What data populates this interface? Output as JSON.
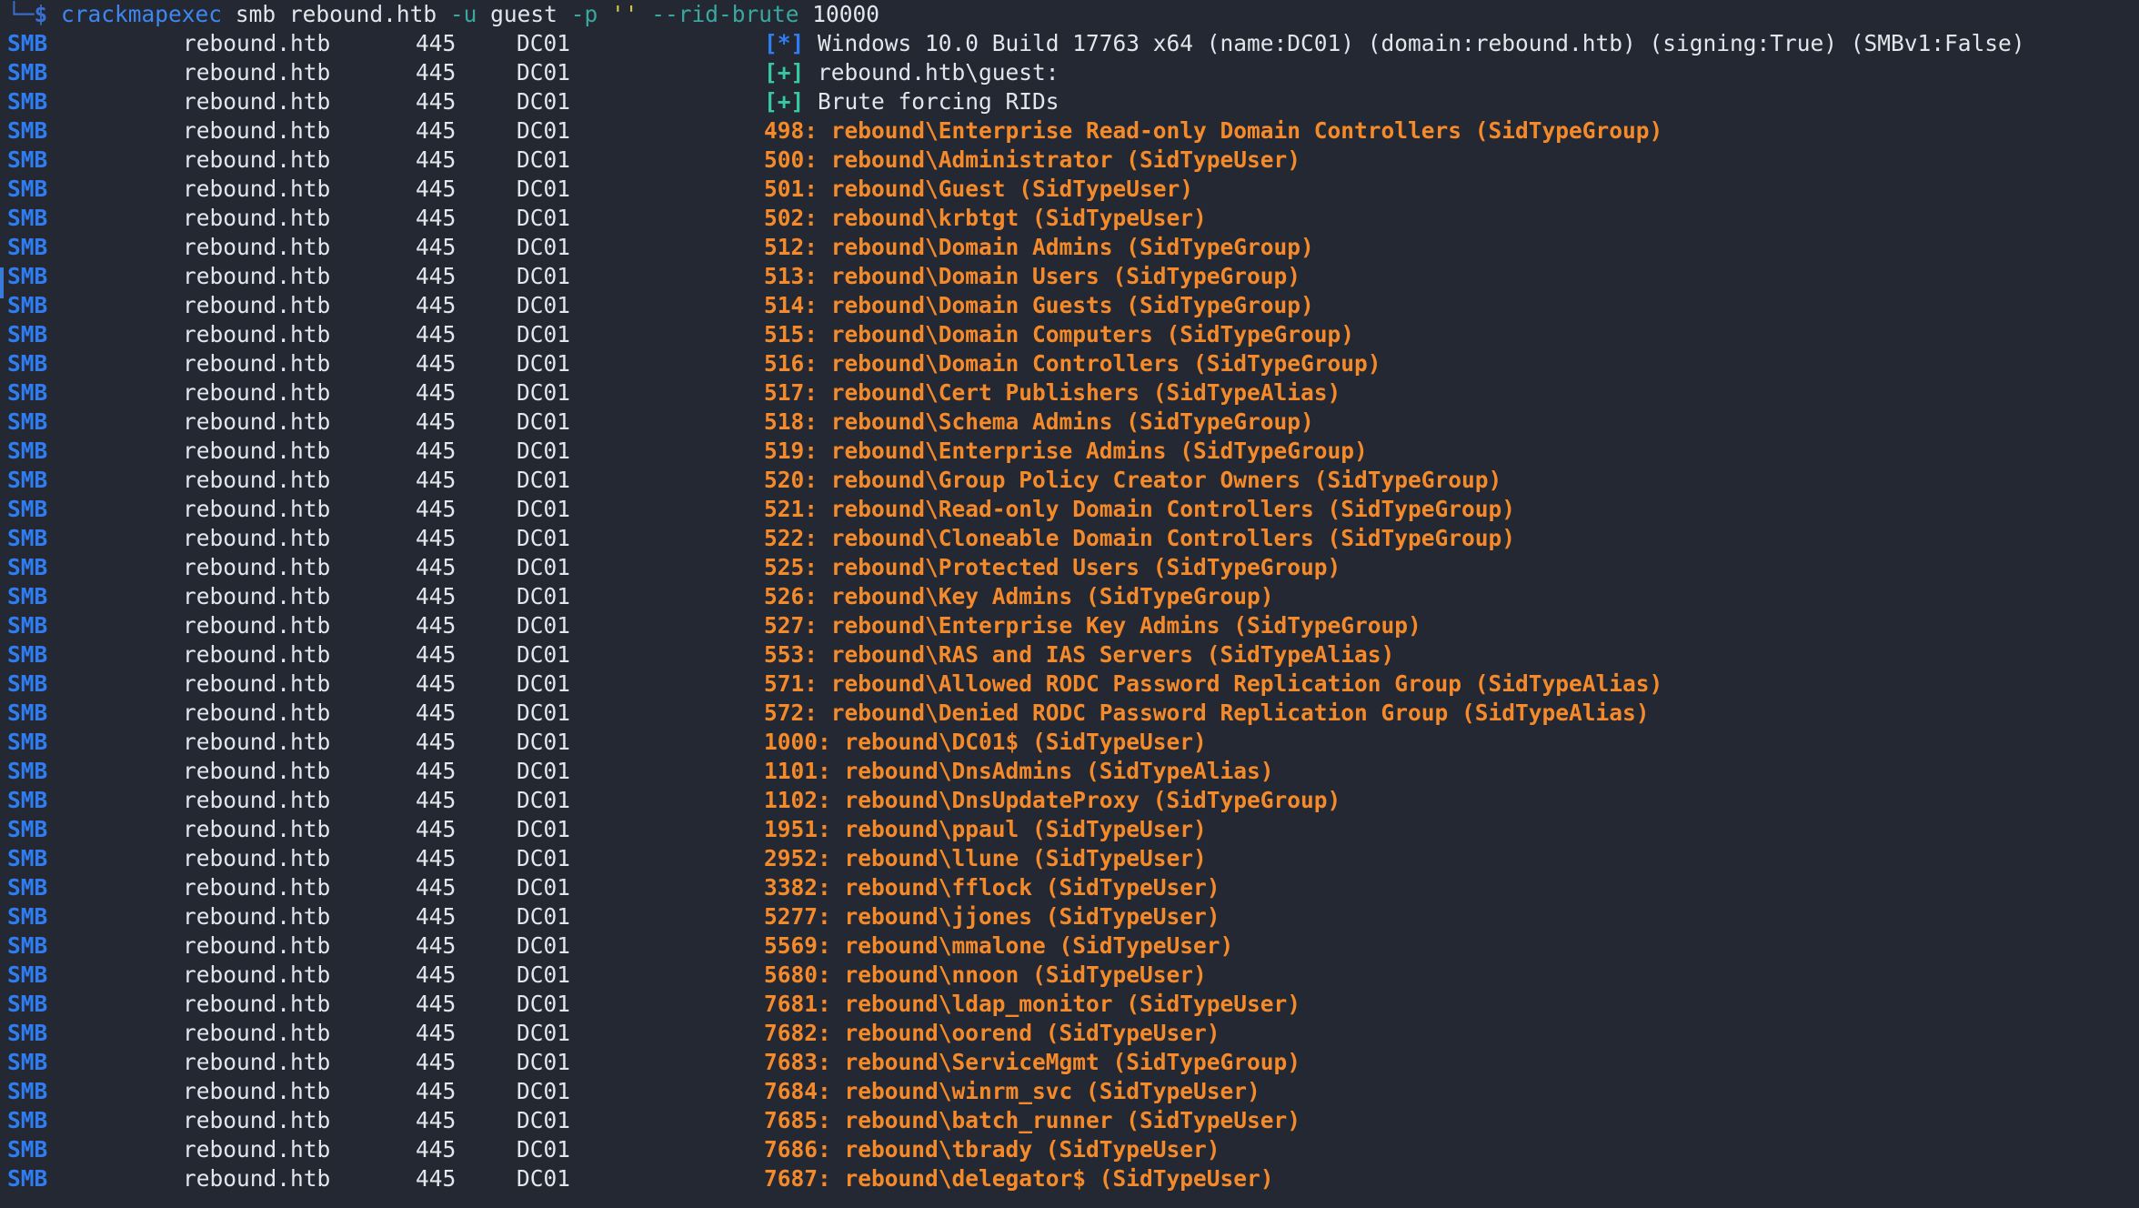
{
  "command": {
    "prompt_tail": "└─",
    "prompt_symbol": "$",
    "program": "crackmapexec",
    "subcommand": "smb",
    "target": "rebound.htb",
    "user_flag": "-u",
    "user_value": "guest",
    "pass_flag": "-p",
    "pass_value": "''",
    "rid_flag": "--rid-brute",
    "rid_value": "10000"
  },
  "host_info": {
    "protocol": "SMB",
    "host": "rebound.htb",
    "port": "445",
    "name": "DC01"
  },
  "status_lines": [
    {
      "marker": "[*]",
      "type": "info",
      "text": "Windows 10.0 Build 17763 x64 (name:DC01) (domain:rebound.htb) (signing:True) (SMBv1:False)"
    },
    {
      "marker": "[+]",
      "type": "success",
      "text": "rebound.htb\\guest:"
    },
    {
      "marker": "[+]",
      "type": "success",
      "text": "Brute forcing RIDs"
    }
  ],
  "rid_results": [
    {
      "rid": "498:",
      "account": "rebound\\Enterprise Read-only Domain Controllers (SidTypeGroup)"
    },
    {
      "rid": "500:",
      "account": "rebound\\Administrator (SidTypeUser)"
    },
    {
      "rid": "501:",
      "account": "rebound\\Guest (SidTypeUser)"
    },
    {
      "rid": "502:",
      "account": "rebound\\krbtgt (SidTypeUser)"
    },
    {
      "rid": "512:",
      "account": "rebound\\Domain Admins (SidTypeGroup)"
    },
    {
      "rid": "513:",
      "account": "rebound\\Domain Users (SidTypeGroup)"
    },
    {
      "rid": "514:",
      "account": "rebound\\Domain Guests (SidTypeGroup)"
    },
    {
      "rid": "515:",
      "account": "rebound\\Domain Computers (SidTypeGroup)"
    },
    {
      "rid": "516:",
      "account": "rebound\\Domain Controllers (SidTypeGroup)"
    },
    {
      "rid": "517:",
      "account": "rebound\\Cert Publishers (SidTypeAlias)"
    },
    {
      "rid": "518:",
      "account": "rebound\\Schema Admins (SidTypeGroup)"
    },
    {
      "rid": "519:",
      "account": "rebound\\Enterprise Admins (SidTypeGroup)"
    },
    {
      "rid": "520:",
      "account": "rebound\\Group Policy Creator Owners (SidTypeGroup)"
    },
    {
      "rid": "521:",
      "account": "rebound\\Read-only Domain Controllers (SidTypeGroup)"
    },
    {
      "rid": "522:",
      "account": "rebound\\Cloneable Domain Controllers (SidTypeGroup)"
    },
    {
      "rid": "525:",
      "account": "rebound\\Protected Users (SidTypeGroup)"
    },
    {
      "rid": "526:",
      "account": "rebound\\Key Admins (SidTypeGroup)"
    },
    {
      "rid": "527:",
      "account": "rebound\\Enterprise Key Admins (SidTypeGroup)"
    },
    {
      "rid": "553:",
      "account": "rebound\\RAS and IAS Servers (SidTypeAlias)"
    },
    {
      "rid": "571:",
      "account": "rebound\\Allowed RODC Password Replication Group (SidTypeAlias)"
    },
    {
      "rid": "572:",
      "account": "rebound\\Denied RODC Password Replication Group (SidTypeAlias)"
    },
    {
      "rid": "1000:",
      "account": "rebound\\DC01$ (SidTypeUser)"
    },
    {
      "rid": "1101:",
      "account": "rebound\\DnsAdmins (SidTypeAlias)"
    },
    {
      "rid": "1102:",
      "account": "rebound\\DnsUpdateProxy (SidTypeGroup)"
    },
    {
      "rid": "1951:",
      "account": "rebound\\ppaul (SidTypeUser)"
    },
    {
      "rid": "2952:",
      "account": "rebound\\llune (SidTypeUser)"
    },
    {
      "rid": "3382:",
      "account": "rebound\\fflock (SidTypeUser)"
    },
    {
      "rid": "5277:",
      "account": "rebound\\jjones (SidTypeUser)"
    },
    {
      "rid": "5569:",
      "account": "rebound\\mmalone (SidTypeUser)"
    },
    {
      "rid": "5680:",
      "account": "rebound\\nnoon (SidTypeUser)"
    },
    {
      "rid": "7681:",
      "account": "rebound\\ldap_monitor (SidTypeUser)"
    },
    {
      "rid": "7682:",
      "account": "rebound\\oorend (SidTypeUser)"
    },
    {
      "rid": "7683:",
      "account": "rebound\\ServiceMgmt (SidTypeGroup)"
    },
    {
      "rid": "7684:",
      "account": "rebound\\winrm_svc (SidTypeUser)"
    },
    {
      "rid": "7685:",
      "account": "rebound\\batch_runner (SidTypeUser)"
    },
    {
      "rid": "7686:",
      "account": "rebound\\tbrady (SidTypeUser)"
    },
    {
      "rid": "7687:",
      "account": "rebound\\delegator$ (SidTypeUser)"
    }
  ],
  "colors": {
    "background": "#242833",
    "protocol_blue": "#2f7df2",
    "success_green": "#37c9a0",
    "result_orange": "#f58a2a",
    "text_default": "#e4e6ec"
  }
}
